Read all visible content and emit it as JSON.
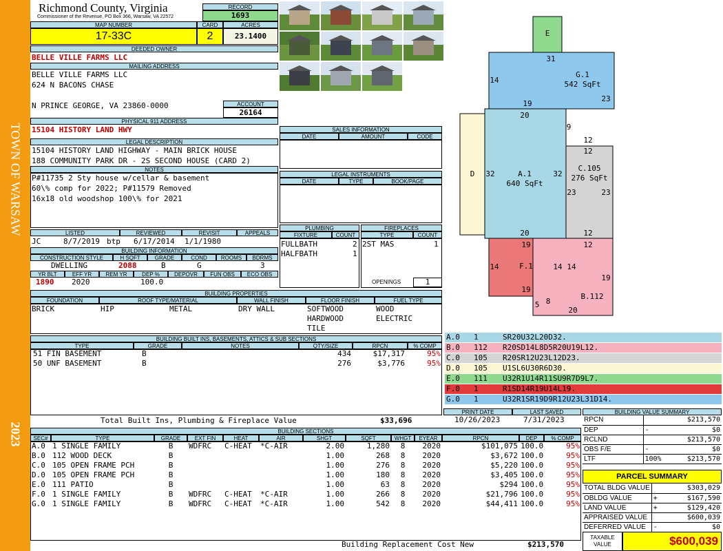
{
  "sidebar": {
    "town": "TOWN OF WARSAW",
    "year": "2023"
  },
  "header": {
    "county": "Richmond County, Virginia",
    "address": "Commissioner of the Revenue, PO Box 366, Warsaw, VA 22572",
    "record_label": "RECORD",
    "record": "1693",
    "map_label": "MAP NUMBER",
    "map_number": "17-33C",
    "card_label": "CARD",
    "card": "2",
    "acres_label": "ACRES",
    "acres": "23.1400"
  },
  "owner": {
    "label": "DEEDED OWNER",
    "name": "BELLE VILLE FARMS LLC",
    "mail_label": "MAILING ADDRESS",
    "mail1": "BELLE VILLE FARMS LLC",
    "mail2": "624 N BACONS CHASE",
    "mail3": "N PRINCE GEORGE, VA 23860-0000",
    "account_label": "ACCOUNT",
    "account": "26164",
    "phys_label": "PHYSICAL 911 ADDRESS",
    "phys": "15104 HISTORY LAND HWY"
  },
  "legal": {
    "label": "LEGAL DESCRIPTION",
    "line1": "15104 HISTORY LAND HIGHWAY - MAIN BRICK HOUSE",
    "line2": "188 COMMUNITY PARK DR - 2S SECOND HOUSE (CARD 2)"
  },
  "notes": {
    "label": "NOTES",
    "line1": "P#11735 2 Sty house w/cellar & basement",
    "line2": "60\\% comp for 2022; P#11579 Removed",
    "line3": "16x18 old woodshop 100\\% for 2021"
  },
  "listing": {
    "listed_label": "LISTED",
    "reviewed_label": "REVIEWED",
    "revisit_label": "REVISIT",
    "appeals_label": "APPEALS",
    "lister": "JC",
    "listed": "8/7/2019",
    "reviewer": "btp",
    "reviewed": "6/17/2014",
    "revisit": "1/1/1980"
  },
  "building_info": {
    "label": "BUILDING INFORMATION",
    "h_cons": "CONSTRUCTION STYLE",
    "h_hsqft": "H SQFT",
    "h_grade": "GRADE",
    "h_cond": "COND",
    "h_rooms": "ROOMS",
    "h_bdrms": "BDRMS",
    "cons": "DWELLING",
    "hsqft": "2088",
    "grade": "B",
    "cond": "G",
    "rooms": "",
    "bdrms": "3",
    "h_yrblt": "YR BLT",
    "h_effyr": "EFF YR",
    "h_remyr": "REM YR",
    "h_dep": "DEP %",
    "h_depovr": "DEPOVR",
    "h_funobs": "FUN OBS",
    "h_ecoobs": "ECO OBS",
    "yrblt": "1890",
    "effyr": "2020",
    "dep": "100.0"
  },
  "properties": {
    "label": "BUILDING PROPERTIES",
    "h_found": "FOUNDATION",
    "h_roof": "ROOF TYPE/MATERIAL",
    "h_wall": "WALL FINISH",
    "h_floor": "FLOOR FINISH",
    "h_fuel": "FUEL TYPE",
    "found": "BRICK",
    "roof_type": "HIP",
    "roof_mat": "METAL",
    "wall": "DRY WALL",
    "floor1": "SOFTWOOD",
    "floor2": "HARDWOOD",
    "floor3": "TILE",
    "fuel1": "WOOD",
    "fuel2": "ELECTRIC"
  },
  "builtins": {
    "label": "BUILDING BUILT INS, BASEMENTS, ATTICS & SUB SECTIONS",
    "headers": [
      "TYPE",
      "GRADE",
      "NOTES",
      "QTY/SIZE",
      "RPCN",
      "% COMP"
    ],
    "rows": [
      {
        "type": "51 FIN BASEMENT",
        "grade": "B",
        "notes": "",
        "qty": "434",
        "rpcn": "$17,317",
        "comp": "95%"
      },
      {
        "type": "50 UNF BASEMENT",
        "grade": "B",
        "notes": "",
        "qty": "276",
        "rpcn": "$3,776",
        "comp": "95%"
      }
    ],
    "total_label": "Total Built Ins, Plumbing & Fireplace Value",
    "total": "$33,696"
  },
  "sales": {
    "label": "SALES INFORMATION",
    "headers": [
      "DATE",
      "AMOUNT",
      "CODE"
    ]
  },
  "instruments": {
    "label": "LEGAL INSTRUMENTS",
    "headers": [
      "DATE",
      "TYPE",
      "BOOK/PAGE"
    ]
  },
  "plumbing": {
    "label": "PLUMBING",
    "h_fix": "FIXTURE",
    "h_count": "COUNT",
    "rows": [
      {
        "fix": "FULLBATH",
        "count": "2"
      },
      {
        "fix": "HALFBATH",
        "count": "1"
      }
    ]
  },
  "fireplaces": {
    "label": "FIREPLACES",
    "h_type": "TYPE",
    "h_count": "COUNT",
    "rows": [
      {
        "type": "2ST MAS",
        "count": "1"
      }
    ],
    "openings_label": "OPENINGS",
    "openings": "1"
  },
  "sketch": {
    "areas": [
      {
        "id": "E",
        "label": "E",
        "sqft": "",
        "color": "#8fd98f"
      },
      {
        "id": "G1",
        "label": "G.1",
        "sqft": "542 SqFt",
        "color": "#8ec8ec"
      },
      {
        "id": "D",
        "label": "D",
        "sqft": "",
        "color": "#fcf6d4"
      },
      {
        "id": "A1",
        "label": "A.1",
        "sqft": "640 SqFt",
        "color": "#a8d8e6"
      },
      {
        "id": "C105",
        "label": "C.105",
        "sqft": "276 SqFt",
        "color": "#d4d4d4"
      },
      {
        "id": "F1",
        "label": "F.1",
        "sqft": "",
        "color": "#ea7878"
      },
      {
        "id": "B112",
        "label": "B.112",
        "sqft": "",
        "color": "#f7b2c0"
      }
    ],
    "dims": [
      "31",
      "14",
      "23",
      "19",
      "20",
      "9",
      "12",
      "12",
      "32",
      "32",
      "23",
      "23",
      "20",
      "12",
      "19",
      "12",
      "14",
      "14",
      "14",
      "19",
      "19",
      "5",
      "8",
      "20"
    ]
  },
  "segments": [
    {
      "sec": "A.0",
      "code": "1",
      "path": "SR20U32L20D32.",
      "color": "#a8d8e6",
      "text": "#000"
    },
    {
      "sec": "B.0",
      "code": "112",
      "path": "R20SD14L8D5R20U19L12.",
      "color": "#f7b2c0",
      "text": "#000"
    },
    {
      "sec": "C.0",
      "code": "105",
      "path": "R20SR12U23L12D23.",
      "color": "#d4d4d4",
      "text": "#000"
    },
    {
      "sec": "D.0",
      "code": "105",
      "path": "U1SL6U30R6D30.",
      "color": "#fcf6d4",
      "text": "#000"
    },
    {
      "sec": "E.0",
      "code": "111",
      "path": "U32R1U14R11SU9R7D9L7.",
      "color": "#8fd98f",
      "text": "#000"
    },
    {
      "sec": "F.0",
      "code": "1",
      "path": "R1SD14R19U14L19.",
      "color": "#e33b3b",
      "text": "#000"
    },
    {
      "sec": "G.0",
      "code": "1",
      "path": "U32R1SR19D9R12U23L31D14.",
      "color": "#8ec8ec",
      "text": "#000"
    }
  ],
  "print": {
    "print_label": "PRINT DATE",
    "print_date": "10/26/2023",
    "saved_label": "LAST SAVED",
    "saved": "7/31/2023"
  },
  "bvs": {
    "label": "BUILDING VALUE SUMMARY",
    "rows": [
      {
        "k": "RPCN",
        "s": "",
        "v": "$213,570"
      },
      {
        "k": "DEP",
        "s": "-",
        "v": "$0"
      },
      {
        "k": "RCLND",
        "s": "",
        "v": "$213,570"
      },
      {
        "k": "OBS F/E",
        "s": "-",
        "v": "$0"
      },
      {
        "k": "LTF",
        "s": "100%",
        "v": "$213,570"
      }
    ]
  },
  "parcel": {
    "label": "PARCEL SUMMARY",
    "rows": [
      {
        "k": "TOTAL BLDG VALUE",
        "s": "",
        "v": "$303,029"
      },
      {
        "k": "OBLDG VALUE",
        "s": "+",
        "v": "$167,590"
      },
      {
        "k": "LAND VALUE",
        "s": "+",
        "v": "$129,420"
      },
      {
        "k": "APPRAISED VALUE",
        "s": "",
        "v": "$600,039"
      },
      {
        "k": "DEFERRED VALUE",
        "s": "-",
        "v": "$0"
      }
    ],
    "taxable_label1": "TAXABLE",
    "taxable_label2": "VALUE",
    "taxable": "$600,039"
  },
  "sections": {
    "label": "BUILDING SECTIONS",
    "headers": [
      "SEC#",
      "TYPE",
      "GRADE",
      "EXT FIN",
      "HEAT",
      "AIR",
      "SHGT",
      "SQFT",
      "WHGT",
      "EYEAR",
      "RPCN",
      "DEP",
      "% COMP"
    ],
    "rows": [
      {
        "sec": "A.0",
        "type": "1 SINGLE FAMILY",
        "grade": "B",
        "ext": "WDFRC",
        "heat": "C-HEAT",
        "air": "*C-AIR",
        "shgt": "2.00",
        "sqft": "1,280",
        "whgt": "8",
        "eyear": "2020",
        "rpcn": "$101,075",
        "dep": "100.0",
        "comp": "95%"
      },
      {
        "sec": "B.0",
        "type": "112 WOOD DECK",
        "grade": "B",
        "ext": "",
        "heat": "",
        "air": "",
        "shgt": "1.00",
        "sqft": "268",
        "whgt": "8",
        "eyear": "2020",
        "rpcn": "$3,672",
        "dep": "100.0",
        "comp": "95%"
      },
      {
        "sec": "C.0",
        "type": "105 OPEN FRAME PCH",
        "grade": "B",
        "ext": "",
        "heat": "",
        "air": "",
        "shgt": "1.00",
        "sqft": "276",
        "whgt": "8",
        "eyear": "2020",
        "rpcn": "$5,220",
        "dep": "100.0",
        "comp": "95%"
      },
      {
        "sec": "D.0",
        "type": "105 OPEN FRAME PCH",
        "grade": "B",
        "ext": "",
        "heat": "",
        "air": "",
        "shgt": "1.00",
        "sqft": "180",
        "whgt": "8",
        "eyear": "2020",
        "rpcn": "$3,405",
        "dep": "100.0",
        "comp": "95%"
      },
      {
        "sec": "E.0",
        "type": "111 PATIO",
        "grade": "B",
        "ext": "",
        "heat": "",
        "air": "",
        "shgt": "1.00",
        "sqft": "63",
        "whgt": "8",
        "eyear": "2020",
        "rpcn": "$294",
        "dep": "100.0",
        "comp": "95%"
      },
      {
        "sec": "F.0",
        "type": "1 SINGLE FAMILY",
        "grade": "B",
        "ext": "WDFRC",
        "heat": "C-HEAT",
        "air": "*C-AIR",
        "shgt": "1.00",
        "sqft": "266",
        "whgt": "8",
        "eyear": "2020",
        "rpcn": "$21,796",
        "dep": "100.0",
        "comp": "95%"
      },
      {
        "sec": "G.0",
        "type": "1 SINGLE FAMILY",
        "grade": "B",
        "ext": "WDFRC",
        "heat": "C-HEAT",
        "air": "*C-AIR",
        "shgt": "1.00",
        "sqft": "542",
        "whgt": "8",
        "eyear": "2020",
        "rpcn": "$44,411",
        "dep": "100.0",
        "comp": "95%"
      }
    ],
    "total_label": "Building Replacement Cost New",
    "total": "$213,570"
  },
  "photos": [
    {
      "sky": "#dfe9f3",
      "ground": "#5f8a3a",
      "house": "#b9a58a"
    },
    {
      "sky": "#cfe0ee",
      "ground": "#6a8f3c",
      "house": "#8a4a36"
    },
    {
      "sky": "#e4edf6",
      "ground": "#7fa24a",
      "house": "#c9c9c9"
    },
    {
      "sky": "#d9e5ef",
      "ground": "#648c3e",
      "house": "#9aa9b5"
    },
    {
      "sky": "#4f7a34",
      "ground": "#6d9440",
      "house": "#4a5a3a"
    },
    {
      "sky": "#d7e4ef",
      "ground": "#5d8a36",
      "house": "#3d4450"
    },
    {
      "sky": "#e2ebf4",
      "ground": "#6a9a3e",
      "house": "#6d7680"
    },
    {
      "sky": "#dbe6f0",
      "ground": "#5b8636",
      "house": "#9a8f80"
    },
    {
      "sky": "#dce7f1",
      "ground": "#4f7a30",
      "house": "#3c3f45"
    },
    {
      "sky": "#d5e2ee",
      "ground": "#6c9746",
      "house": "#a0a7b0"
    },
    {
      "sky": "#e0e9f2",
      "ground": "#72a044",
      "house": "#5f6670"
    }
  ]
}
